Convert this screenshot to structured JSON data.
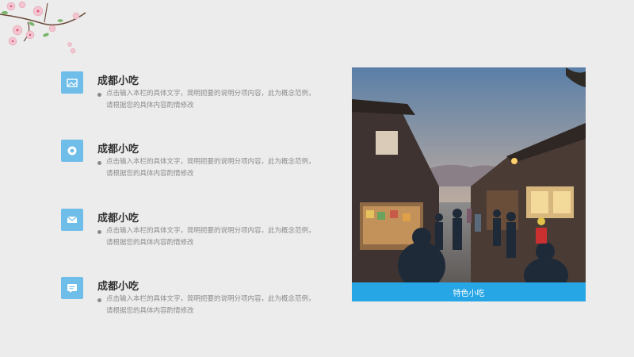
{
  "items": [
    {
      "icon": "image-icon",
      "title": "成都小吃",
      "desc": "点击输入本栏的具体文字，简明扼要的说明分项内容，此为概念范例，请根据您的具体内容酌情修改"
    },
    {
      "icon": "badge-icon",
      "title": "成都小吃",
      "desc": "点击输入本栏的具体文字，简明扼要的说明分项内容，此为概念范例，请根据您的具体内容酌情修改"
    },
    {
      "icon": "mail-icon",
      "title": "成都小吃",
      "desc": "点击输入本栏的具体文字，简明扼要的说明分项内容，此为概念范例，请根据您的具体内容酌情修改"
    },
    {
      "icon": "chat-icon",
      "title": "成都小吃",
      "desc": "点击输入本栏的具体文字，简明扼要的说明分项内容，此为概念范例，请根据您的具体内容酌情修改"
    }
  ],
  "photo": {
    "caption": "特色小吃"
  },
  "colors": {
    "accent": "#27a6e5",
    "icon_bg": "#6fbde9",
    "background": "#ececec",
    "title": "#333333",
    "desc": "#8c8c8c"
  }
}
